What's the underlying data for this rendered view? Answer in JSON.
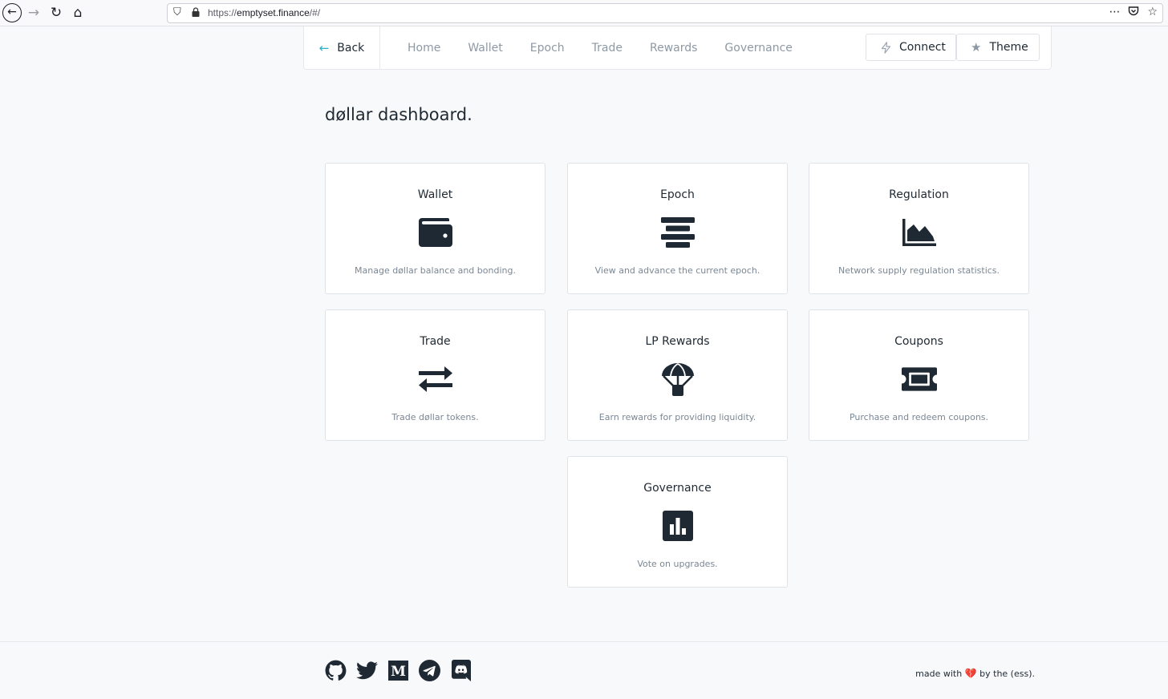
{
  "browser": {
    "url_prefix": "https://",
    "url_host": "emptyset.finance",
    "url_path": "/#/",
    "overflow_icon": "⋯",
    "pocket_icon": "pocket-icon",
    "bookmark_star": "☆"
  },
  "nav": {
    "back_label": "Back",
    "links": [
      "Home",
      "Wallet",
      "Epoch",
      "Trade",
      "Rewards",
      "Governance"
    ],
    "connect_label": "Connect",
    "theme_label": "Theme"
  },
  "page": {
    "title": "døllar dashboard."
  },
  "cards": [
    {
      "title": "Wallet",
      "icon": "wallet-icon",
      "desc": "Manage døllar balance and bonding."
    },
    {
      "title": "Epoch",
      "icon": "epoch-icon",
      "desc": "View and advance the current epoch."
    },
    {
      "title": "Regulation",
      "icon": "area-chart-icon",
      "desc": "Network supply regulation statistics."
    },
    {
      "title": "Trade",
      "icon": "swap-icon",
      "desc": "Trade døllar tokens."
    },
    {
      "title": "LP Rewards",
      "icon": "parachute-icon",
      "desc": "Earn rewards for providing liquidity."
    },
    {
      "title": "Coupons",
      "icon": "ticket-icon",
      "desc": "Purchase and redeem coupons."
    },
    {
      "title": "Governance",
      "icon": "poll-icon",
      "desc": "Vote on upgrades."
    }
  ],
  "footer": {
    "social": [
      "github-icon",
      "twitter-icon",
      "medium-icon",
      "telegram-icon",
      "discord-icon"
    ],
    "medium_letter": "M",
    "credit_before": "made with",
    "credit_after": "by the (ess).",
    "heart": "💔"
  },
  "colors": {
    "accent": "#28b2c8",
    "icon": "#1f2933",
    "muted": "#8e99a4",
    "border": "#dfe3e8"
  }
}
